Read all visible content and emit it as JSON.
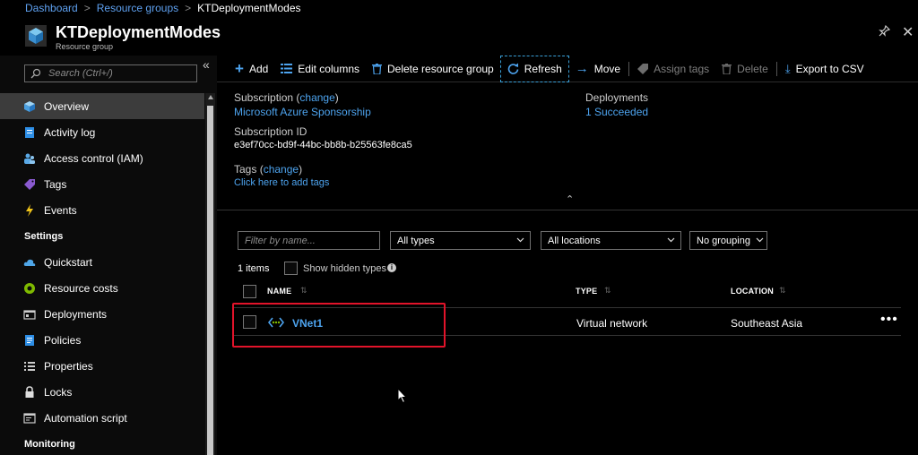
{
  "breadcrumb": {
    "items": [
      "Dashboard",
      "Resource groups"
    ],
    "current": "KTDeploymentModes",
    "separator": ">"
  },
  "header": {
    "title": "KTDeploymentModes",
    "subtitle": "Resource group",
    "icon": "resource-group-cube-icon"
  },
  "sidebar": {
    "search_placeholder": "Search (Ctrl+/)",
    "items": [
      {
        "label": "Overview",
        "icon": "overview-cube-icon",
        "active": true
      },
      {
        "label": "Activity log",
        "icon": "activity-log-icon"
      },
      {
        "label": "Access control (IAM)",
        "icon": "people-icon"
      },
      {
        "label": "Tags",
        "icon": "tag-icon"
      },
      {
        "label": "Events",
        "icon": "lightning-icon"
      }
    ],
    "settings_title": "Settings",
    "settings": [
      {
        "label": "Quickstart",
        "icon": "cloud-icon"
      },
      {
        "label": "Resource costs",
        "icon": "cost-circle-icon"
      },
      {
        "label": "Deployments",
        "icon": "deployments-icon"
      },
      {
        "label": "Policies",
        "icon": "policy-icon"
      },
      {
        "label": "Properties",
        "icon": "properties-list-icon"
      },
      {
        "label": "Locks",
        "icon": "lock-icon"
      },
      {
        "label": "Automation script",
        "icon": "script-icon"
      }
    ],
    "monitoring_title": "Monitoring"
  },
  "toolbar": {
    "add": "Add",
    "edit_columns": "Edit columns",
    "delete_rg": "Delete resource group",
    "refresh": "Refresh",
    "move": "Move",
    "assign_tags": "Assign tags",
    "delete": "Delete",
    "export": "Export to CSV"
  },
  "essentials": {
    "subscription_label": "Subscription",
    "change": "change",
    "subscription_value": "Microsoft Azure Sponsorship",
    "subscription_id_label": "Subscription ID",
    "subscription_id": "e3ef70cc-bd9f-44bc-bb8b-b25563fe8ca5",
    "tags_label": "Tags",
    "tags_link": "Click here to add tags",
    "deployments_label": "Deployments",
    "deployments_value": "1 Succeeded"
  },
  "filters": {
    "name_placeholder": "Filter by name...",
    "types": "All types",
    "locations": "All locations",
    "grouping": "No grouping"
  },
  "list": {
    "count": "1 items",
    "show_hidden": "Show hidden types",
    "columns": [
      "NAME",
      "TYPE",
      "LOCATION"
    ],
    "rows": [
      {
        "name": "VNet1",
        "type": "Virtual network",
        "location": "Southeast Asia",
        "icon": "virtual-network-icon"
      }
    ]
  },
  "colors": {
    "link": "#4da3ee",
    "highlight": "#e2132a",
    "background": "#000000",
    "active_nav": "#3c3c3c"
  }
}
